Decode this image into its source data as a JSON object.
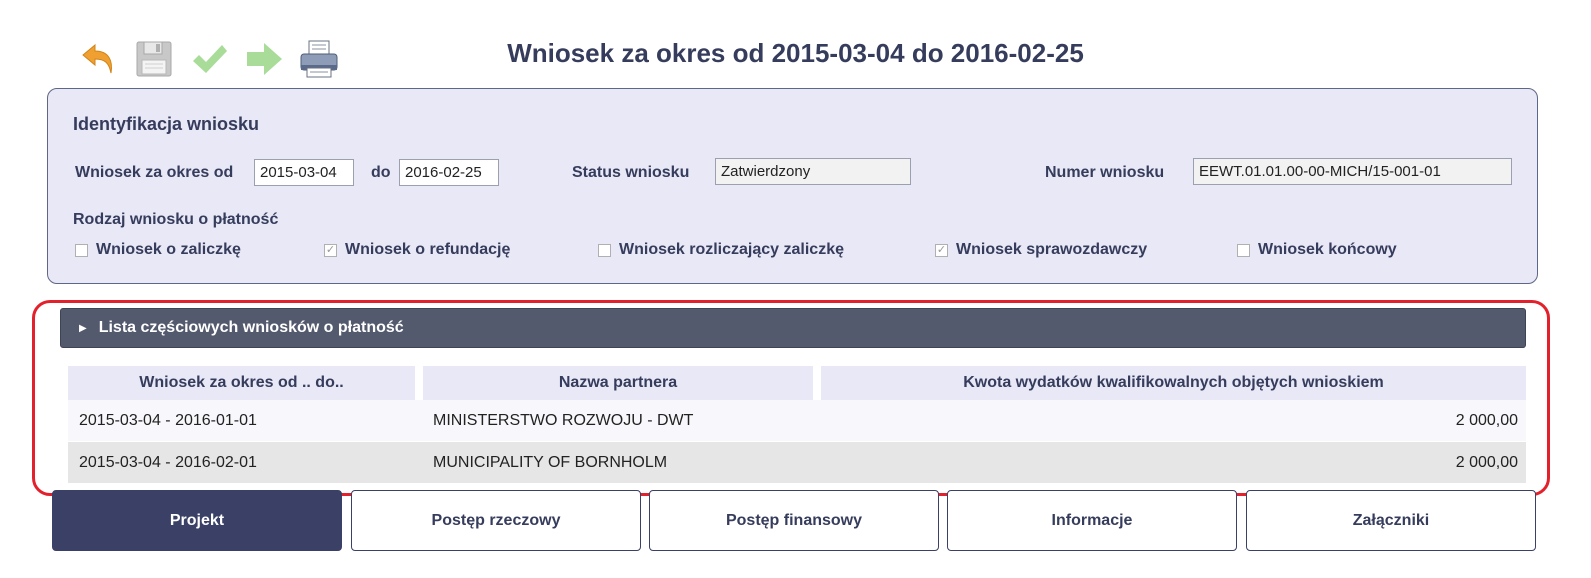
{
  "toolbar": {
    "buttons": [
      {
        "icon": "undo-arrow-icon",
        "color": "#f0a030"
      },
      {
        "icon": "floppy-disk-icon",
        "color": "#b8b8b8"
      },
      {
        "icon": "checkmark-icon",
        "color": "#9ed890"
      },
      {
        "icon": "forward-arrow-icon",
        "color": "#9ed890"
      },
      {
        "icon": "printer-icon",
        "color": "#5a6a8a"
      }
    ]
  },
  "page_title": "Wniosek za okres od 2015-03-04 do 2016-02-25",
  "identification": {
    "title": "Identyfikacja wniosku",
    "period_from_label": "Wniosek za okres od",
    "period_from_value": "2015-03-04",
    "period_to_label": "do",
    "period_to_value": "2016-02-25",
    "status_label": "Status wniosku",
    "status_value": "Zatwierdzony",
    "number_label": "Numer wniosku",
    "number_value": "EEWT.01.01.00-00-MICH/15-001-01",
    "payment_type_label": "Rodzaj wniosku o płatność",
    "payment_types": [
      {
        "label": "Wniosek o zaliczkę",
        "checked": false
      },
      {
        "label": "Wniosek o refundację",
        "checked": true
      },
      {
        "label": "Wniosek rozliczający zaliczkę",
        "checked": false
      },
      {
        "label": "Wniosek sprawozdawczy",
        "checked": true
      },
      {
        "label": "Wniosek końcowy",
        "checked": false
      }
    ]
  },
  "partial_list": {
    "header": "Lista częściowych wniosków o płatność",
    "columns": [
      "Wniosek za okres od .. do..",
      "Nazwa partnera",
      "Kwota wydatków kwalifikowalnych objętych wnioskiem"
    ],
    "rows": [
      {
        "period": "2015-03-04 - 2016-01-01",
        "partner": "MINISTERSTWO ROZWOJU - DWT",
        "amount": "2 000,00"
      },
      {
        "period": "2015-03-04 - 2016-02-01",
        "partner": "MUNICIPALITY OF BORNHOLM",
        "amount": "2 000,00"
      }
    ]
  },
  "tabs": [
    {
      "label": "Projekt",
      "active": true
    },
    {
      "label": "Postęp rzeczowy",
      "active": false
    },
    {
      "label": "Postęp finansowy",
      "active": false
    },
    {
      "label": "Informacje",
      "active": false
    },
    {
      "label": "Załączniki",
      "active": false
    }
  ],
  "colors": {
    "accent": "#363c5c",
    "panel_bg": "#e8e8f6",
    "highlight_frame": "#e3212c",
    "section_header_bg": "#545a6e",
    "active_tab_bg": "#3a4066"
  }
}
